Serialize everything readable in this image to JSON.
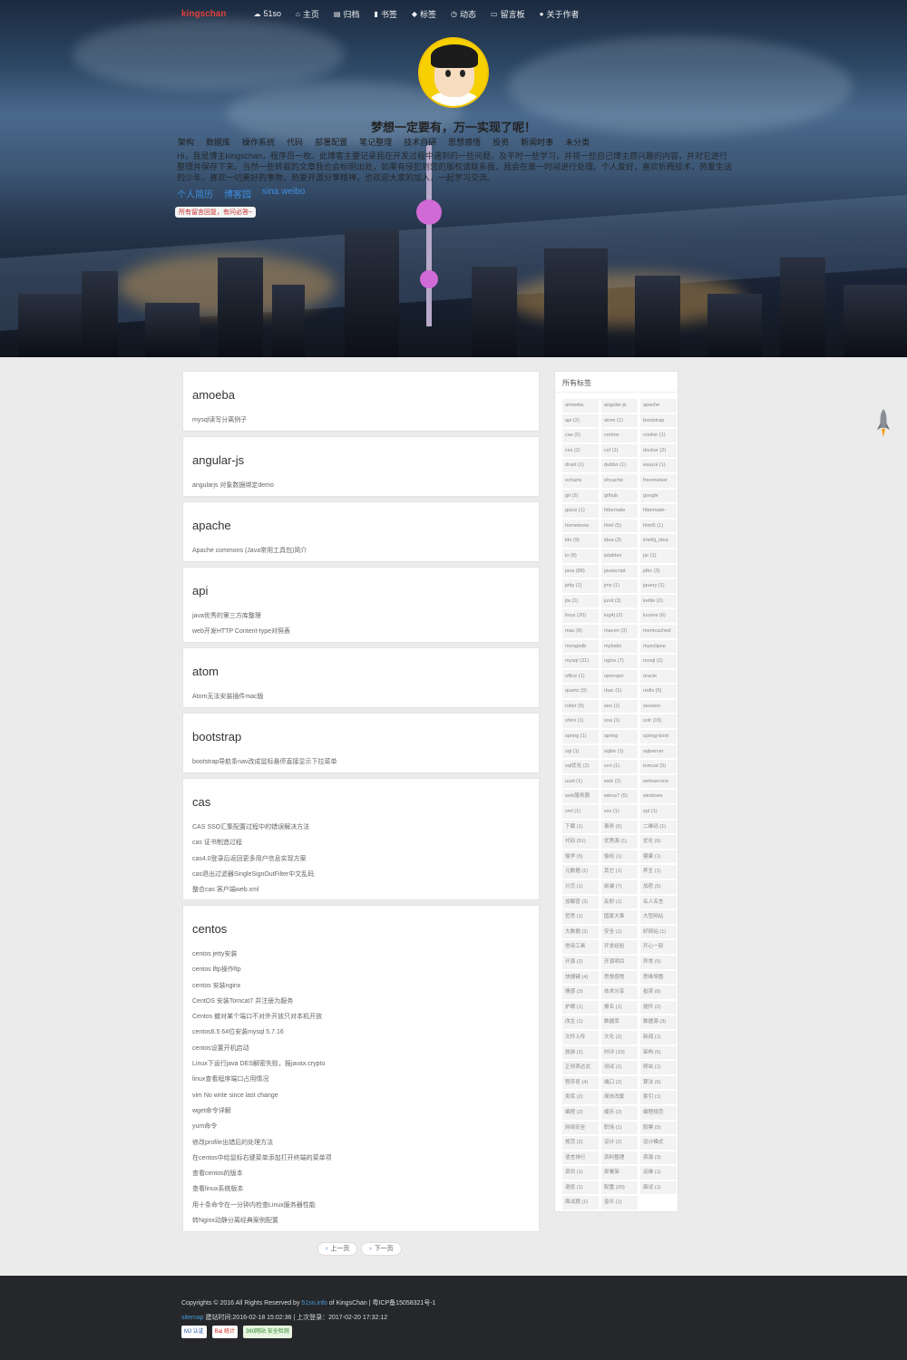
{
  "nav": {
    "brand": "kingschan",
    "items": [
      {
        "icon": "cloud-icon",
        "label": "51so"
      },
      {
        "icon": "home-icon",
        "label": "主页"
      },
      {
        "icon": "file-icon",
        "label": "归档"
      },
      {
        "icon": "bookmark-icon",
        "label": "书签"
      },
      {
        "icon": "tag-icon",
        "label": "标签"
      },
      {
        "icon": "clock-icon",
        "label": "动态"
      },
      {
        "icon": "comment-icon",
        "label": "留言板"
      },
      {
        "icon": "user-icon",
        "label": "关于作者"
      }
    ]
  },
  "hero": {
    "slogan": "梦想一定要有，万一实现了呢！",
    "categories": [
      "架构",
      "数据库",
      "操作系统",
      "代码",
      "部署配置",
      "笔记整理",
      "技术自研",
      "思想感悟",
      "投资",
      "新闻时事",
      "未分类"
    ],
    "intro": "Hi，我是博主kingschan，程序员一枚。此博客主要记录我在开发过程中遇到的一些问题，及平时一些学习，并将一些自己博主感兴趣的内容，并对它进行整理并保存下来。当然一些转载的文章我也会标明出处，如果有侵犯到您的版权请联系我，我会在第一时间进行处理。个人爱好，喜欢折腾技术，热爱生活的少年，喜欢一切美好的事物，热爱开源分享精神，也欢迎大家的加入，一起学习交流。",
    "links": [
      "个人简历",
      "博客园",
      "sina weibo"
    ],
    "message_tag": "所有留言回复，有问必答~"
  },
  "cards": [
    {
      "title": "amoeba",
      "items": [
        "mysql读写分离例子"
      ]
    },
    {
      "title": "angular-js",
      "items": [
        "angularjs 对象数据绑定demo"
      ]
    },
    {
      "title": "apache",
      "items": [
        "Apache commons (Java常用工具包)简介"
      ]
    },
    {
      "title": "api",
      "items": [
        "java优秀的第三方库整理",
        "web开发HTTP Content-type对照表"
      ]
    },
    {
      "title": "atom",
      "items": [
        "Atom无法安装插件mac版"
      ]
    },
    {
      "title": "bootstrap",
      "items": [
        "bootstrap导航条nav改成鼠标悬停直接显示下拉菜单"
      ]
    },
    {
      "title": "cas",
      "items": [
        "CAS SSO汇集配置过程中的错误解决方法",
        "cas 证书制造过程",
        "cas4.0登录后返回更多用户信息实现方案",
        "cas退出过滤器SingleSignOutFilter中文乱码",
        "整合cas 客户端web.xml"
      ]
    },
    {
      "title": "centos",
      "items": [
        "centos jetty安装",
        "centos lftp操作ftp",
        "centos 安装nginx",
        "CentOS 安装Tomcat7 并注册为服务",
        "Centos 撤对某个端口不对外开放只对本机开放",
        "centos6.5 64位安装mysql 5.7.16",
        "centos设置开机启动",
        "Linux下运行java DES解密失败，报javax.crypto",
        "linux查看程序端口占用情况",
        "vim No write since last change",
        "wget命令详解",
        "yum命令",
        "修改profile出错后的处理方法",
        "在centos中给鼠标右键菜单添加打开终端的菜单项",
        "查看centos的版本",
        "查看linux系统版本",
        "用十条命令在一分钟内检查Linux服务器性能",
        "转Nginx动静分离经典案例配置"
      ]
    }
  ],
  "sidebar": {
    "title": "所有标签",
    "tags": [
      "amoeba",
      "angular-js",
      "apache",
      "api (2)",
      "atom (1)",
      "bootstrap",
      "cas (5)",
      "centos",
      "cookie (1)",
      "css (2)",
      "cxf (1)",
      "docker (2)",
      "druid (1)",
      "dubbo (1)",
      "easyui (1)",
      "echarts",
      "ehcache",
      "freemarker",
      "git (2)",
      "github",
      "google",
      "guice (1)",
      "hibernate",
      "hibernate-",
      "homebrew",
      "html (5)",
      "html5 (1)",
      "ide (9)",
      "idea (3)",
      "intellij_idea",
      "io (8)",
      "iptables",
      "jar (1)",
      "java (88)",
      "javascript",
      "jdbc (3)",
      "jetty (1)",
      "jmx (1)",
      "jquery (1)",
      "jta (1)",
      "junit (3)",
      "kettle (2)",
      "linux (20)",
      "log4j (2)",
      "lucene (6)",
      "mac (8)",
      "maven (3)",
      "memcached",
      "mongodb",
      "mybatis",
      "myeclipse",
      "mysql (31)",
      "nginx (7)",
      "nosql (2)",
      "office (1)",
      "openvpn",
      "oracle",
      "quartz (9)",
      "rbac (1)",
      "redis (5)",
      "roller (9)",
      "seo (1)",
      "session",
      "shiro (1)",
      "soa (1)",
      "solr (15)",
      "spring (1)",
      "spring",
      "spring-boot",
      "sql (1)",
      "sqlite (1)",
      "sqlserver",
      "sql优化 (2)",
      "svn (1)",
      "tomcat (5)",
      "uuid (1)",
      "web (2)",
      "webservice",
      "web服务器",
      "wince7 (5)",
      "windows",
      "xml (1)",
      "xss (1)",
      "zpl (1)",
      "下载 (1)",
      "事务 (5)",
      "二维码 (1)",
      "代码 (51)",
      "优秀源 (1)",
      "优化 (6)",
      "偷学 (5)",
      "偷经 (1)",
      "健康 (1)",
      "元数据 (1)",
      "其它 (1)",
      "养生 (1)",
      "分页 (1)",
      "前端 (7)",
      "加密 (5)",
      "加解密 (2)",
      "反射 (1)",
      "名人名言",
      "哲思 (1)",
      "国家大事",
      "大型网站",
      "大数据 (2)",
      "安全 (1)",
      "好网站 (1)",
      "常用工具",
      "开发经验",
      "开心一刻",
      "开源 (2)",
      "开源项目",
      "异常 (5)",
      "快捷键 (4)",
      "思想感悟",
      "思维导图",
      "情感 (3)",
      "技术分享",
      "投资 (6)",
      "护眼 (1)",
      "报名 (1)",
      "插件 (2)",
      "改生 (1)",
      "数据库",
      "数据源 (3)",
      "文件上传",
      "文化 (2)",
      "新闻 (1)",
      "旅游 (2)",
      "时评 (10)",
      "架构 (6)",
      "正则表达式",
      "测试 (1)",
      "爬虫 (1)",
      "程序员 (4)",
      "端口 (2)",
      "算法 (6)",
      "类库 (2)",
      "简体改繁",
      "索引 (1)",
      "编程 (2)",
      "缓存 (2)",
      "编程规范",
      "网络安全",
      "职场 (1)",
      "股票 (5)",
      "规范 (2)",
      "设计 (2)",
      "设计模式",
      "语言排行",
      "资料整理",
      "资源 (3)",
      "资讯 (1)",
      "部署架",
      "运维 (1)",
      "退役 (1)",
      "配置 (20)",
      "面试 (1)",
      "面试题 (1)",
      "音乐 (1)"
    ]
  },
  "pager": {
    "prev": "上一页",
    "next": "下一页"
  },
  "footer": {
    "copyright_prefix": "Copyrights © 2016 All Rights Reserved by",
    "site_link": "51so.info",
    "copyright_suffix": "of KingsChan | 粤ICP备15058321号-1",
    "sitemap": "sitemap",
    "times": "建站时间:2016-02-18 15:02:36 | 上次登录：2017-02-20 17:32:12",
    "badges": [
      "MJ 认证",
      "Bai 统计",
      "360网站 安全检测"
    ]
  },
  "colors": {
    "accent": "#3d8fe0",
    "brand": "#e0403a",
    "footer_bg": "#25272a",
    "page_bg": "#ebebeb"
  }
}
